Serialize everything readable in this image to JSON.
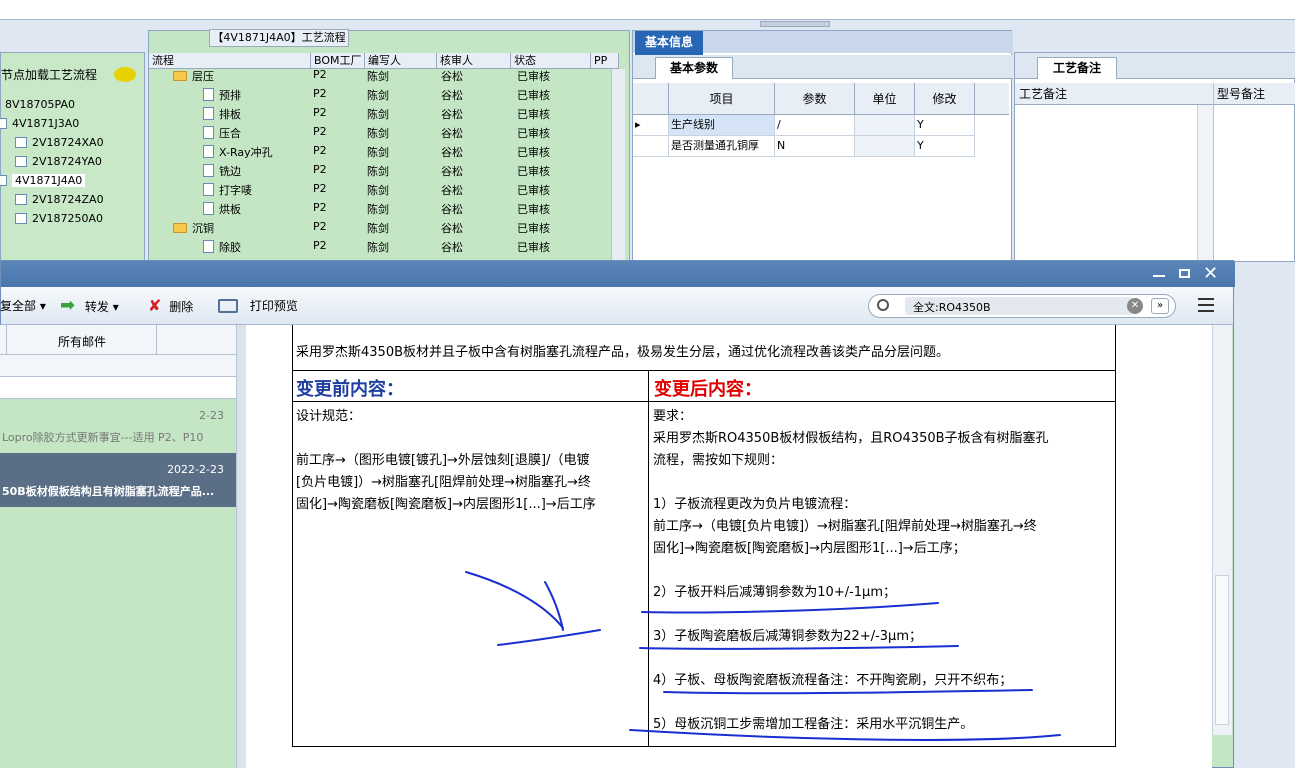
{
  "top_panel": {
    "title": "【4V1871J4A0】工艺流程",
    "node_load_label": "节点加载工艺流程"
  },
  "left_tree": [
    "8V18705PA0",
    "4V1871J3A0",
    "2V18724XA0",
    "2V18724YA0",
    "4V1871J4A0",
    "2V18724ZA0",
    "2V187250A0"
  ],
  "flow_headers": [
    "流程",
    "BOM工厂",
    "编写人",
    "核审人",
    "状态",
    "PP"
  ],
  "flow_rows": [
    {
      "name": "层压",
      "bom": "P2",
      "writer": "陈剑",
      "reviewer": "谷松",
      "status": "已审核",
      "icon": "folder"
    },
    {
      "name": "预排",
      "bom": "P2",
      "writer": "陈剑",
      "reviewer": "谷松",
      "status": "已审核",
      "icon": "doc"
    },
    {
      "name": "排板",
      "bom": "P2",
      "writer": "陈剑",
      "reviewer": "谷松",
      "status": "已审核",
      "icon": "doc"
    },
    {
      "name": "压合",
      "bom": "P2",
      "writer": "陈剑",
      "reviewer": "谷松",
      "status": "已审核",
      "icon": "doc"
    },
    {
      "name": "X-Ray冲孔",
      "bom": "P2",
      "writer": "陈剑",
      "reviewer": "谷松",
      "status": "已审核",
      "icon": "doc"
    },
    {
      "name": "铣边",
      "bom": "P2",
      "writer": "陈剑",
      "reviewer": "谷松",
      "status": "已审核",
      "icon": "doc"
    },
    {
      "name": "打字唛",
      "bom": "P2",
      "writer": "陈剑",
      "reviewer": "谷松",
      "status": "已审核",
      "icon": "doc"
    },
    {
      "name": "烘板",
      "bom": "P2",
      "writer": "陈剑",
      "reviewer": "谷松",
      "status": "已审核",
      "icon": "doc"
    },
    {
      "name": "沉铜",
      "bom": "P2",
      "writer": "陈剑",
      "reviewer": "谷松",
      "status": "已审核",
      "icon": "folder"
    },
    {
      "name": "除胶",
      "bom": "P2",
      "writer": "陈剑",
      "reviewer": "谷松",
      "status": "已审核",
      "icon": "doc"
    }
  ],
  "basic_info": {
    "tab_label": "基本信息",
    "params_tab": "基本参数",
    "headers": [
      "项目",
      "参数",
      "单位",
      "修改"
    ],
    "rows": [
      {
        "item": "生产线别",
        "param": "/",
        "unit": "",
        "modify": "Y"
      },
      {
        "item": "是否测量通孔铜厚",
        "param": "N",
        "unit": "",
        "modify": "Y"
      }
    ]
  },
  "process_notes": {
    "tab_label": "工艺备注",
    "col1": "工艺备注",
    "col2": "型号备注"
  },
  "mail_window": {
    "toolbar": {
      "reply_all": "复全部",
      "forward": "转发",
      "delete": "删除",
      "print_preview": "打印预览"
    },
    "search_value": "全文:RO4350B",
    "list_header": "所有邮件",
    "mails": [
      {
        "date": "2-23",
        "subject": "Lopro除胶方式更新事宜---适用 P2、P10",
        "selected": false
      },
      {
        "date": "2022-2-23",
        "subject": "50B板材假板结构且有树脂塞孔流程产品...",
        "selected": true
      }
    ],
    "doc": {
      "intro": "采用罗杰斯4350B板材并且子板中含有树脂塞孔流程产品，极易发生分层，通过优化流程改善该类产品分层问题。",
      "before_title": "变更前内容：",
      "after_title": "变更后内容：",
      "before_lines": [
        "设计规范：",
        "",
        "前工序→（图形电镀[镀孔]→外层蚀刻[退膜]/（电镀",
        "[负片电镀]）→树脂塞孔[阻焊前处理→树脂塞孔→终",
        "固化]→陶瓷磨板[陶瓷磨板]→内层图形1[...]→后工序"
      ],
      "after_lines": [
        "要求：",
        "采用罗杰斯RO4350B板材假板结构，且RO4350B子板含有树脂塞孔",
        "流程，需按如下规则：",
        "",
        "1）子板流程更改为负片电镀流程：",
        "前工序→（电镀[负片电镀]）→树脂塞孔[阻焊前处理→树脂塞孔→终",
        "固化]→陶瓷磨板[陶瓷磨板]→内层图形1[...]→后工序；",
        "",
        "2）子板开料后减薄铜参数为10+/-1μm；",
        "",
        "3）子板陶瓷磨板后减薄铜参数为22+/-3μm；",
        "",
        "4）子板、母板陶瓷磨板流程备注：不开陶瓷刷，只开不织布；",
        "",
        "5）母板沉铜工步需增加工程备注：采用水平沉铜生产。"
      ]
    }
  },
  "colors": {
    "accent_blue": "#1f5fa8",
    "before_title": "#1f3fa0",
    "after_title": "#e00000",
    "panel_green": "#c5e6c5",
    "annotation_ink": "#1a2fd0"
  }
}
